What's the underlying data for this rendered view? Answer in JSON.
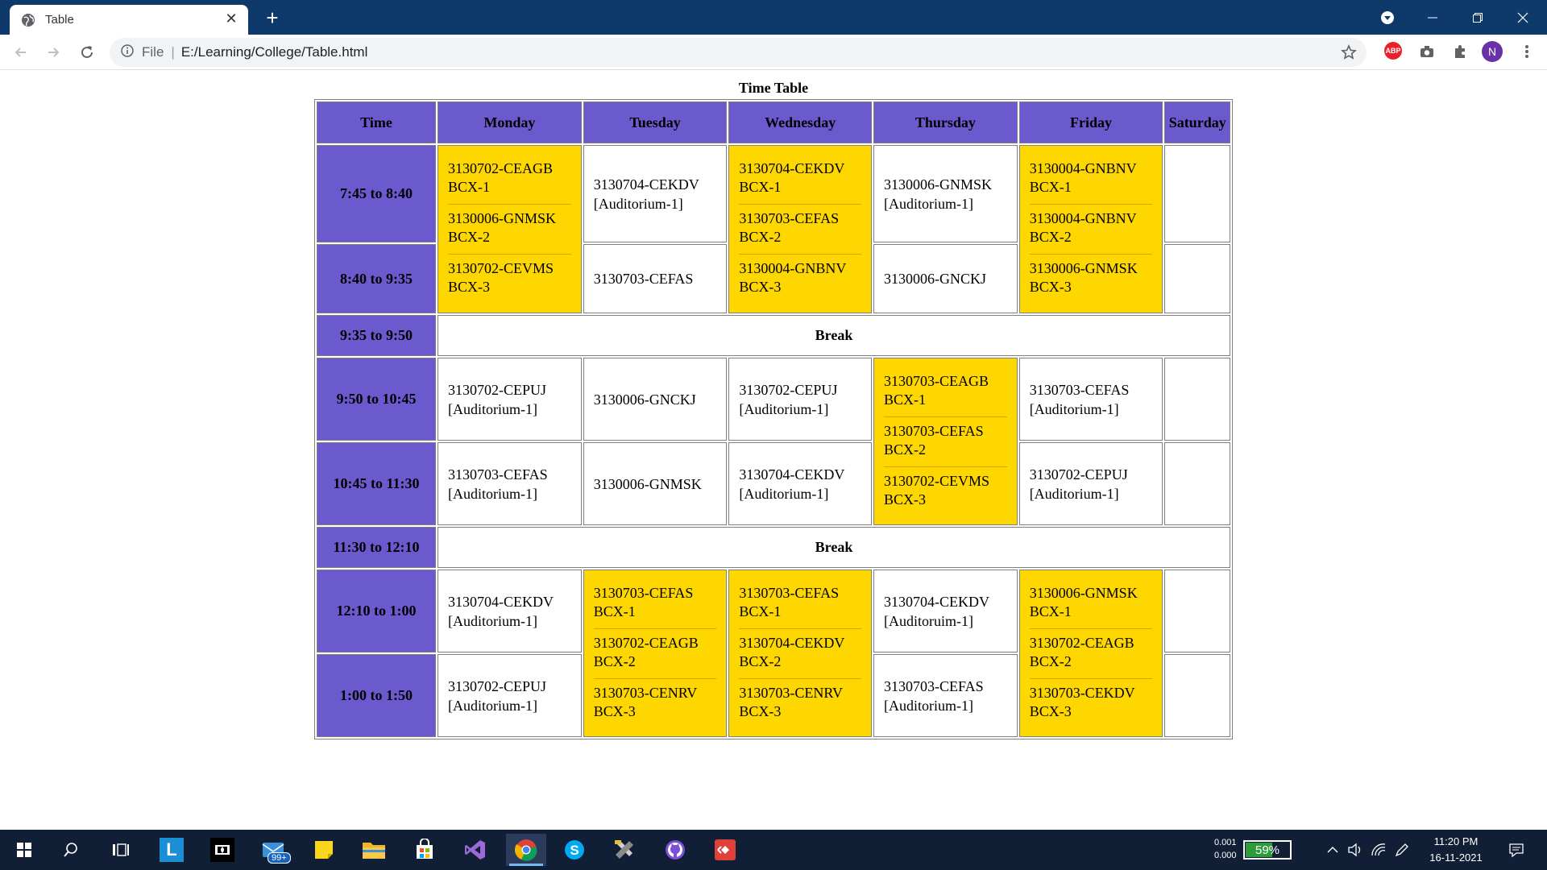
{
  "browser": {
    "tab_title": "Table",
    "omnibox_label": "File",
    "url": "E:/Learning/College/Table.html",
    "avatar_letter": "N",
    "abp_label": "ABP"
  },
  "page": {
    "title": "Time Table",
    "headers": [
      "Time",
      "Monday",
      "Tuesday",
      "Wednesday",
      "Thursday",
      "Friday",
      "Saturday"
    ],
    "times": [
      "7:45 to 8:40",
      "8:40 to 9:35",
      "9:35 to 9:50",
      "9:50 to 10:45",
      "10:45 to 11:30",
      "11:30 to 12:10",
      "12:10 to 1:00",
      "1:00 to 1:50"
    ],
    "break_label": "Break",
    "cells": {
      "mon_b1": [
        [
          "3130702-CEAGB",
          "BCX-1"
        ],
        [
          "3130006-GNMSK",
          "BCX-2"
        ],
        [
          "3130702-CEVMS",
          "BCX-3"
        ]
      ],
      "tue_1": [
        "3130704-CEKDV",
        "[Auditorium-1]"
      ],
      "wed_b1": [
        [
          "3130704-CEKDV",
          "BCX-1"
        ],
        [
          "3130703-CEFAS",
          "BCX-2"
        ],
        [
          "3130004-GNBNV",
          "BCX-3"
        ]
      ],
      "thu_1": [
        "3130006-GNMSK",
        "[Auditorium-1]"
      ],
      "fri_b1": [
        [
          "3130004-GNBNV",
          "BCX-1"
        ],
        [
          "3130004-GNBNV",
          "BCX-2"
        ],
        [
          "3130006-GNMSK",
          "BCX-3"
        ]
      ],
      "tue_2": "3130703-CEFAS",
      "thu_2": "3130006-GNCKJ",
      "mon_4": [
        "3130702-CEPUJ",
        "[Auditorium-1]"
      ],
      "tue_4": "3130006-GNCKJ",
      "wed_4": [
        "3130702-CEPUJ",
        "[Auditorium-1]"
      ],
      "thu_b2": [
        [
          "3130703-CEAGB",
          "BCX-1"
        ],
        [
          "3130703-CEFAS",
          "BCX-2"
        ],
        [
          "3130702-CEVMS",
          "BCX-3"
        ]
      ],
      "fri_4": [
        "3130703-CEFAS",
        "[Auditorium-1]"
      ],
      "mon_5": [
        "3130703-CEFAS",
        "[Auditorium-1]"
      ],
      "tue_5": "3130006-GNMSK",
      "wed_5": [
        "3130704-CEKDV",
        "[Auditorium-1]"
      ],
      "fri_5": [
        "3130702-CEPUJ",
        "[Auditorium-1]"
      ],
      "mon_7": [
        "3130704-CEKDV",
        "[Auditorium-1]"
      ],
      "tue_b3": [
        [
          "3130703-CEFAS",
          "BCX-1"
        ],
        [
          "3130702-CEAGB",
          "BCX-2"
        ],
        [
          "3130703-CENRV",
          "BCX-3"
        ]
      ],
      "wed_b3": [
        [
          "3130703-CEFAS",
          "BCX-1"
        ],
        [
          "3130704-CEKDV",
          "BCX-2"
        ],
        [
          "3130703-CENRV",
          "BCX-3"
        ]
      ],
      "thu_7": [
        "3130704-CEKDV",
        "[Auditoruim-1]"
      ],
      "fri_b3": [
        [
          "3130006-GNMSK",
          "BCX-1"
        ],
        [
          "3130702-CEAGB",
          "BCX-2"
        ],
        [
          "3130703-CEKDV",
          "BCX-3"
        ]
      ],
      "mon_8": [
        "3130702-CEPUJ",
        "[Auditorium-1]"
      ],
      "thu_8": [
        "3130703-CEFAS",
        "[Auditorium-1]"
      ]
    }
  },
  "taskbar": {
    "mail_badge": "99+",
    "net_up": "0.001",
    "net_down": "0.000",
    "battery_percent": "59%",
    "battery_level": 0.59,
    "clock_time": "11:20 PM",
    "clock_date": "16-11-2021",
    "launcher_letter": "L"
  },
  "colors": {
    "header_bg": "#6a5acd",
    "highlight_bg": "#ffd700",
    "titlebar_bg": "#0d3a6b",
    "taskbar_bg": "#101e36"
  }
}
